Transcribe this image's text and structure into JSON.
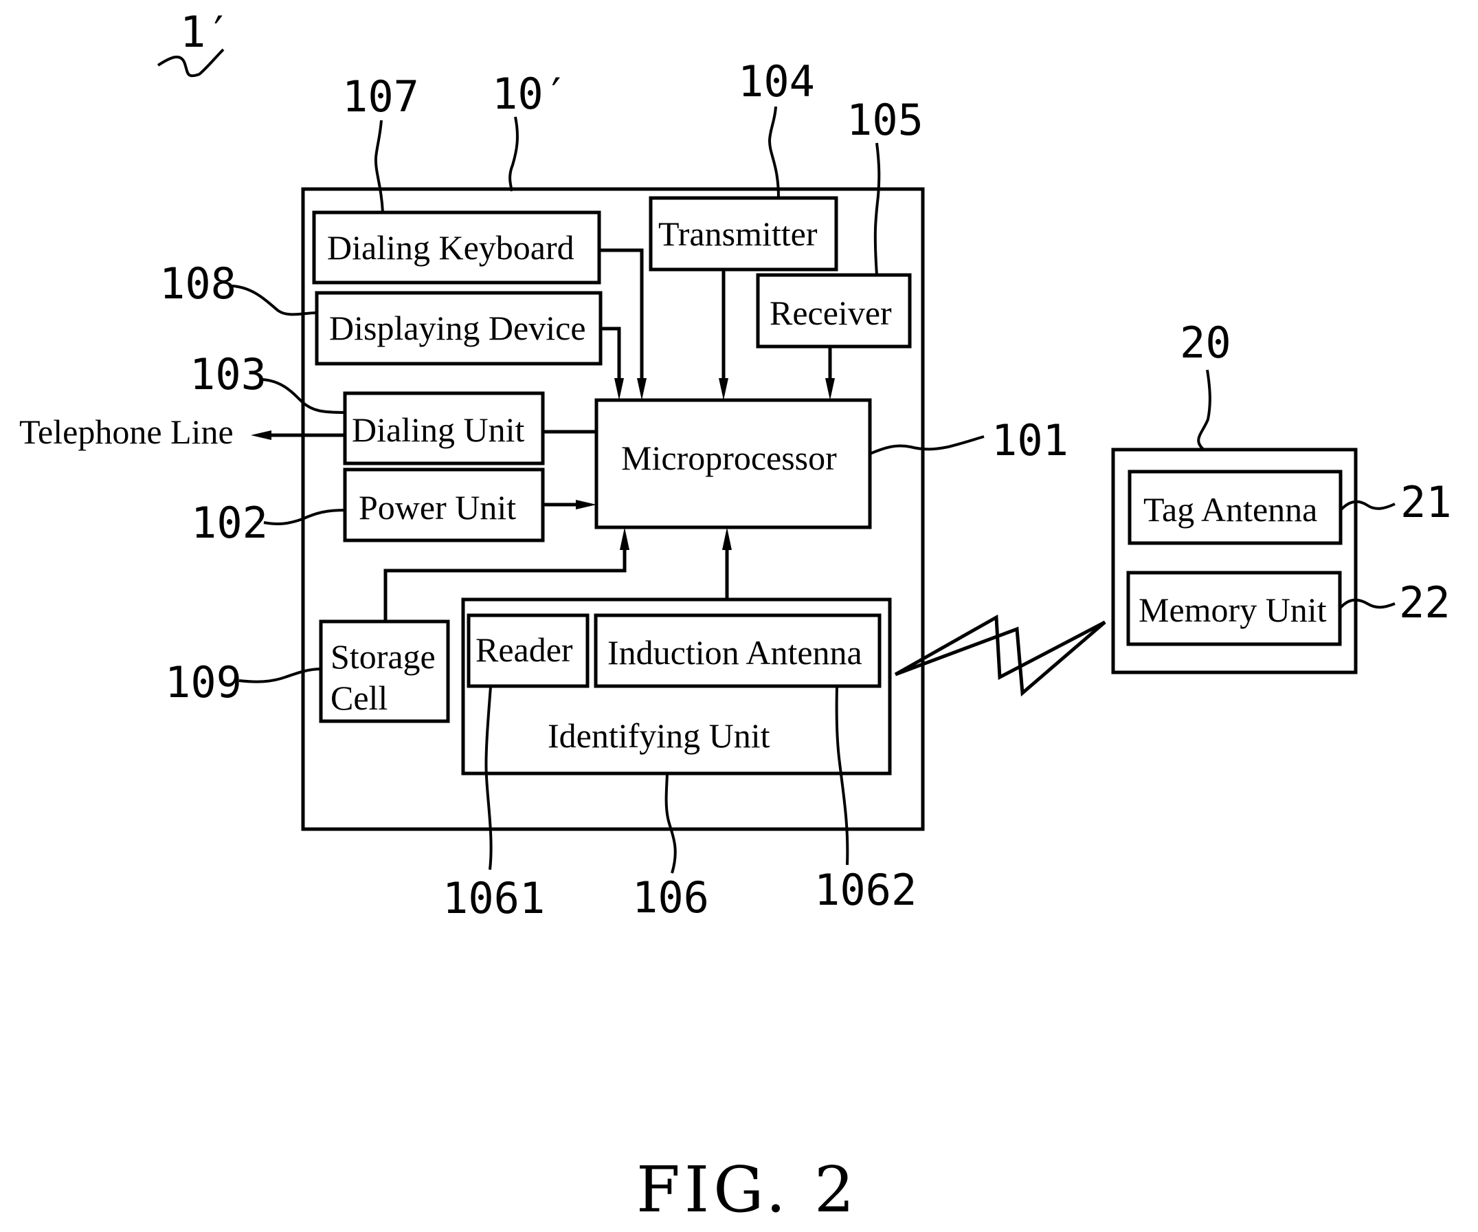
{
  "figure": {
    "caption": "FIG. 2",
    "system_ref": "1′"
  },
  "telephone_device": {
    "ref": "10′",
    "blocks": {
      "dialing_keyboard": {
        "label": "Dialing Keyboard",
        "ref": "107"
      },
      "displaying_device": {
        "label": "Displaying Device",
        "ref": "108"
      },
      "transmitter": {
        "label": "Transmitter",
        "ref": "104"
      },
      "receiver": {
        "label": "Receiver",
        "ref": "105"
      },
      "dialing_unit": {
        "label": "Dialing Unit",
        "ref": "103"
      },
      "power_unit": {
        "label": "Power Unit",
        "ref": "102"
      },
      "microprocessor": {
        "label": "Microprocessor",
        "ref": "101"
      },
      "storage_cell": {
        "label_line1": "Storage",
        "label_line2": "Cell",
        "ref": "109"
      },
      "identifying_unit": {
        "label": "Identifying Unit",
        "ref": "106"
      },
      "reader": {
        "label": "Reader",
        "ref": "1061"
      },
      "induction_antenna": {
        "label": "Induction Antenna",
        "ref": "1062"
      }
    },
    "external": {
      "telephone_line": "Telephone Line"
    }
  },
  "tag": {
    "ref": "20",
    "blocks": {
      "tag_antenna": {
        "label": "Tag Antenna",
        "ref": "21"
      },
      "memory_unit": {
        "label": "Memory Unit",
        "ref": "22"
      }
    }
  },
  "connections": [
    {
      "from": "Dialing Keyboard",
      "to": "Microprocessor",
      "arrow": true
    },
    {
      "from": "Displaying Device",
      "to": "Microprocessor",
      "arrow": true
    },
    {
      "from": "Transmitter",
      "to": "Microprocessor",
      "arrow": true
    },
    {
      "from": "Receiver",
      "to": "Microprocessor",
      "arrow": true
    },
    {
      "from": "Dialing Unit",
      "to": "Microprocessor",
      "arrow": false
    },
    {
      "from": "Dialing Unit",
      "to": "Telephone Line",
      "arrow": true
    },
    {
      "from": "Power Unit",
      "to": "Microprocessor",
      "arrow": true
    },
    {
      "from": "Storage Cell",
      "to": "Microprocessor",
      "arrow": true
    },
    {
      "from": "Identifying Unit",
      "to": "Microprocessor",
      "arrow": true
    },
    {
      "from": "Induction Antenna",
      "to": "Tag",
      "arrow": false,
      "style": "wireless"
    }
  ]
}
